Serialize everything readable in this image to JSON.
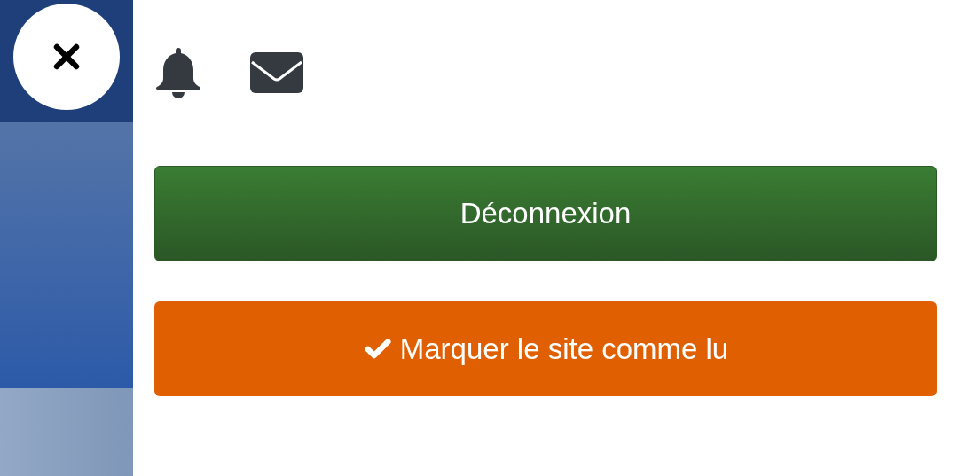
{
  "actions": [
    {
      "kind": "logout",
      "label": "Déconnexion"
    },
    {
      "kind": "mark_read",
      "label": "Marquer le site comme lu"
    }
  ]
}
